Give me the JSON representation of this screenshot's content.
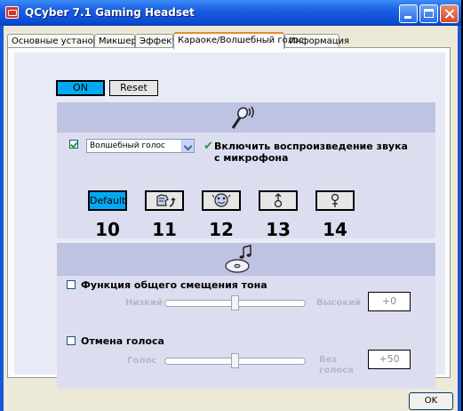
{
  "window": {
    "title": "QCyber 7.1 Gaming Headset"
  },
  "tabs": [
    {
      "label": "Основные установки"
    },
    {
      "label": "Микшер"
    },
    {
      "label": "Эффект"
    },
    {
      "label": "Караоке/Волшебный голос"
    },
    {
      "label": "Информация"
    }
  ],
  "toolbar": {
    "on_label": "ON",
    "reset_label": "Reset"
  },
  "magic_voice": {
    "enabled": true,
    "selected": "Волшебный голос",
    "mic_playback_label_line1": "Включить воспроизведение звука",
    "mic_playback_label_line2": "с микрофона",
    "default_label": "Default",
    "numbers": [
      "10",
      "11",
      "12",
      "13",
      "14"
    ]
  },
  "pitch": {
    "label": "Функция общего смещения тона",
    "checked": false,
    "low_label": "Низкий",
    "high_label": "Высокий",
    "value": "+0",
    "level": 0.5
  },
  "voice_cancel": {
    "label": "Отмена голоса",
    "checked": false,
    "low_label": "Голос",
    "high_label_line1": "Без",
    "high_label_line2": "голоса",
    "value": "+50",
    "level": 0.5
  },
  "footer": {
    "ok_label": "OK"
  },
  "colors": {
    "accent": "#02a9f2",
    "titlebar": "#0c4cd2",
    "check": "#21a121"
  }
}
